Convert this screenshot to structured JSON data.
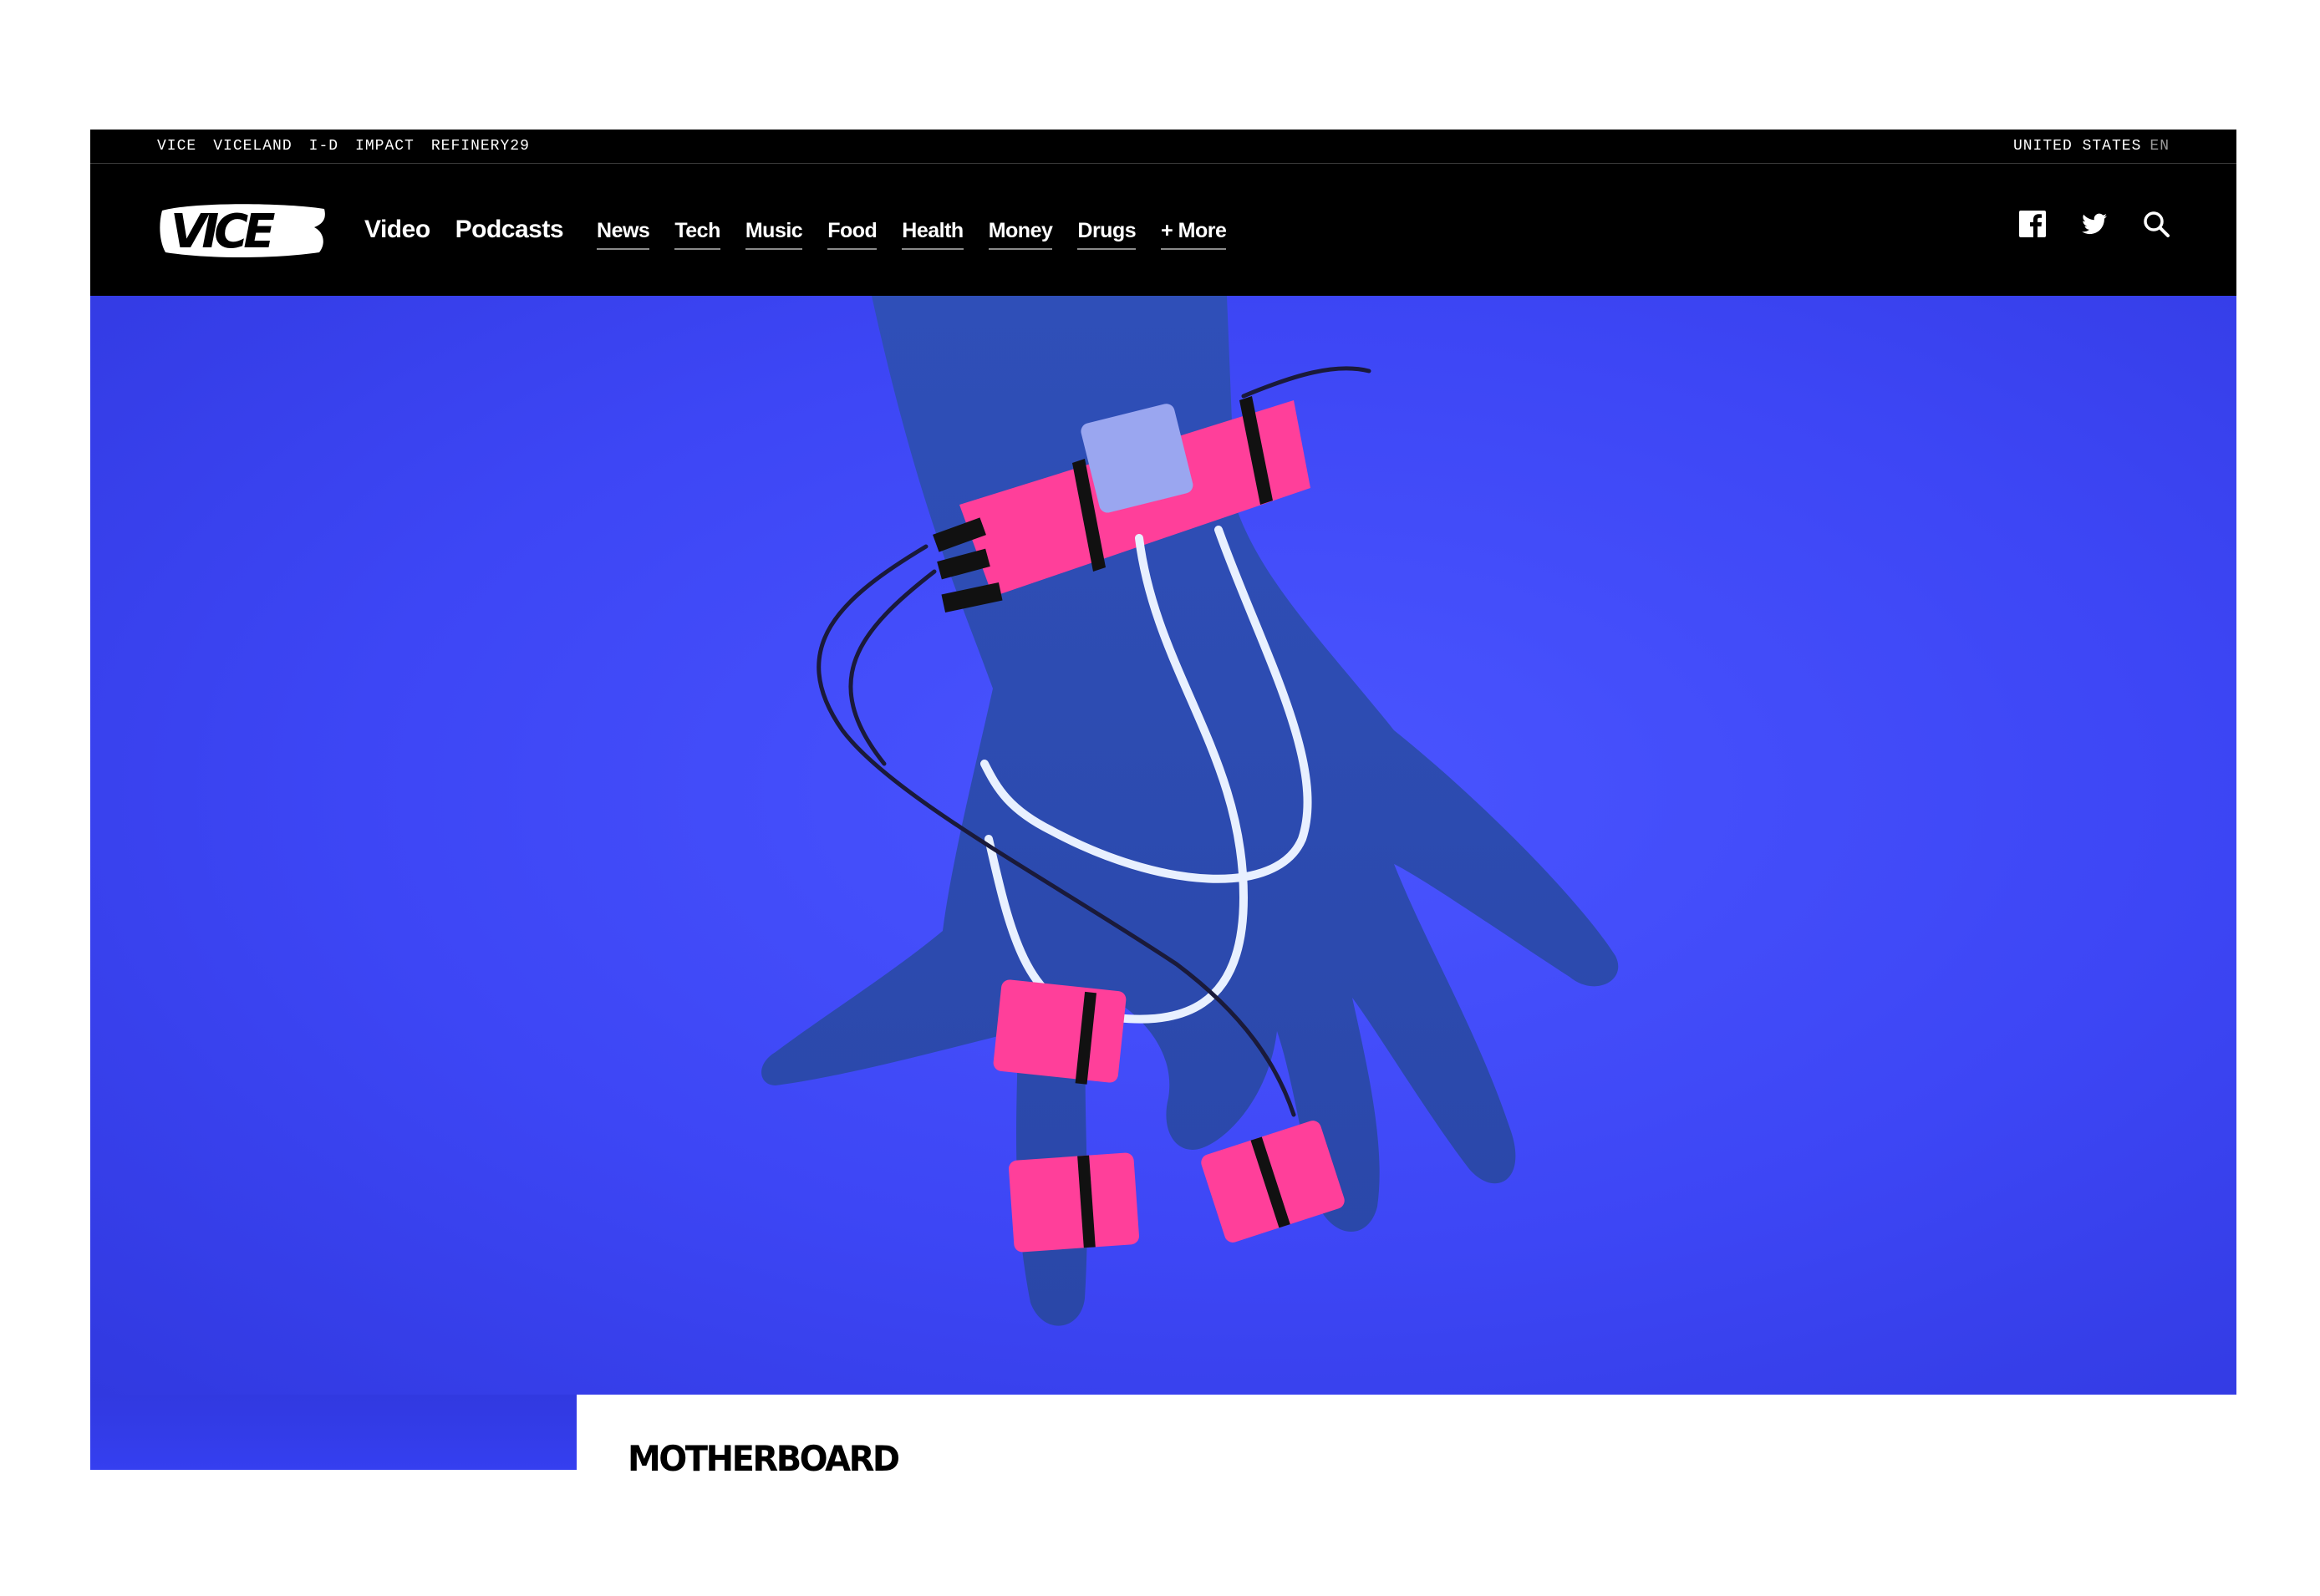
{
  "topbar": {
    "brands": [
      "VICE",
      "VICELAND",
      "I-D",
      "IMPACT",
      "REFINERY29"
    ],
    "region": "UNITED STATES",
    "language": "EN"
  },
  "nav": {
    "logo_text": "VICE",
    "primary": [
      "Video",
      "Podcasts"
    ],
    "sections": [
      "News",
      "Tech",
      "Music",
      "Food",
      "Health",
      "Money",
      "Drugs",
      "+ More"
    ],
    "icons": [
      "facebook-icon",
      "twitter-icon",
      "search-icon"
    ]
  },
  "hero": {
    "background_color": "#3d46f5",
    "accent_band_color": "#ff3f9a"
  },
  "article": {
    "channel": "MOTHERBOARD"
  }
}
